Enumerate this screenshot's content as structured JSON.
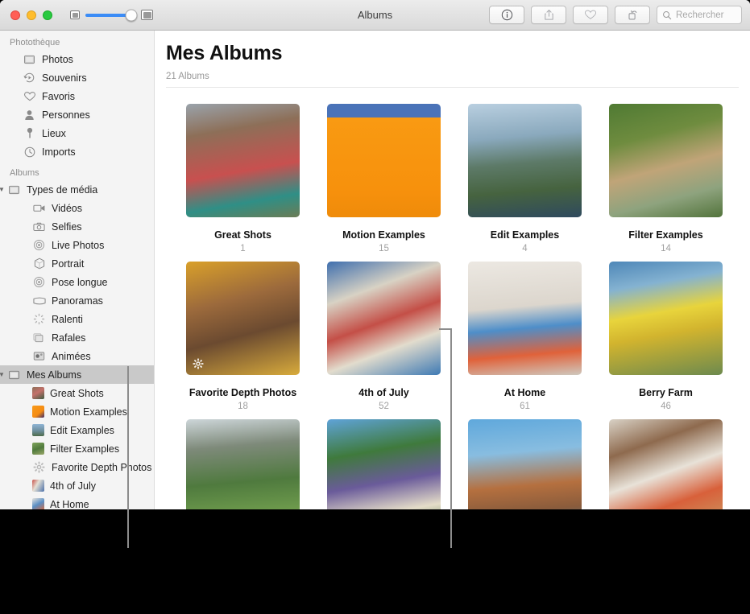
{
  "window": {
    "title": "Albums",
    "traffic_lights": [
      "close",
      "minimize",
      "zoom"
    ],
    "zoom_slider": {
      "min_icon": "small-thumbnail-icon",
      "max_icon": "large-thumbnail-icon",
      "value_percent": 92
    }
  },
  "toolbar": {
    "buttons": [
      {
        "name": "info-button",
        "icon": "info-icon"
      },
      {
        "name": "share-button",
        "icon": "share-icon"
      },
      {
        "name": "favorite-button",
        "icon": "heart-icon"
      },
      {
        "name": "rotate-button",
        "icon": "rotate-icon"
      }
    ],
    "search": {
      "placeholder": "Rechercher",
      "icon": "search-icon",
      "value": ""
    }
  },
  "sidebar": {
    "sections": [
      {
        "title": "Photothèque",
        "items": [
          {
            "label": "Photos",
            "icon": "photos-icon"
          },
          {
            "label": "Souvenirs",
            "icon": "memories-icon"
          },
          {
            "label": "Favoris",
            "icon": "heart-icon"
          },
          {
            "label": "Personnes",
            "icon": "person-icon"
          },
          {
            "label": "Lieux",
            "icon": "pin-icon"
          },
          {
            "label": "Imports",
            "icon": "clock-icon"
          }
        ]
      },
      {
        "title": "Albums",
        "items": [
          {
            "label": "Types de média",
            "icon": "folder-icon",
            "expanded": true
          },
          {
            "label": "Vidéos",
            "icon": "video-icon",
            "indent": 2
          },
          {
            "label": "Selfies",
            "icon": "camera-icon",
            "indent": 2
          },
          {
            "label": "Live Photos",
            "icon": "live-photo-icon",
            "indent": 2
          },
          {
            "label": "Portrait",
            "icon": "portrait-icon",
            "indent": 2
          },
          {
            "label": "Pose longue",
            "icon": "long-exposure-icon",
            "indent": 2
          },
          {
            "label": "Panoramas",
            "icon": "panorama-icon",
            "indent": 2
          },
          {
            "label": "Ralenti",
            "icon": "slow-motion-icon",
            "indent": 2
          },
          {
            "label": "Rafales",
            "icon": "burst-icon",
            "indent": 2
          },
          {
            "label": "Animées",
            "icon": "animated-icon",
            "indent": 2
          },
          {
            "label": "Mes Albums",
            "icon": "folder-icon",
            "expanded": true,
            "selected": true
          },
          {
            "label": "Great Shots",
            "icon": "album-thumbnail",
            "indent": 2
          },
          {
            "label": "Motion Examples",
            "icon": "album-thumbnail",
            "indent": 2
          },
          {
            "label": "Edit Examples",
            "icon": "album-thumbnail",
            "indent": 2
          },
          {
            "label": "Filter Examples",
            "icon": "album-thumbnail",
            "indent": 2
          },
          {
            "label": "Favorite Depth Photos",
            "icon": "gear-icon",
            "indent": 2
          },
          {
            "label": "4th of July",
            "icon": "album-thumbnail",
            "indent": 2
          },
          {
            "label": "At Home",
            "icon": "album-thumbnail",
            "indent": 2
          }
        ]
      }
    ]
  },
  "main": {
    "title": "Mes Albums",
    "subtitle": "21 Albums",
    "albums": [
      {
        "name": "Great Shots",
        "count": "1"
      },
      {
        "name": "Motion Examples",
        "count": "15"
      },
      {
        "name": "Edit Examples",
        "count": "4"
      },
      {
        "name": "Filter Examples",
        "count": "14"
      },
      {
        "name": "Favorite Depth Photos",
        "count": "18",
        "badge": "gear-icon"
      },
      {
        "name": "4th of July",
        "count": "52"
      },
      {
        "name": "At Home",
        "count": "61"
      },
      {
        "name": "Berry Farm",
        "count": "46"
      },
      {
        "name": "",
        "count": ""
      },
      {
        "name": "",
        "count": ""
      },
      {
        "name": "",
        "count": ""
      },
      {
        "name": "",
        "count": ""
      }
    ]
  },
  "colors": {
    "accent": "#3b8cf6",
    "sidebar_bg": "#f4f4f4",
    "selection": "#c9c9c9",
    "leader_line": "#8c8c8c"
  }
}
